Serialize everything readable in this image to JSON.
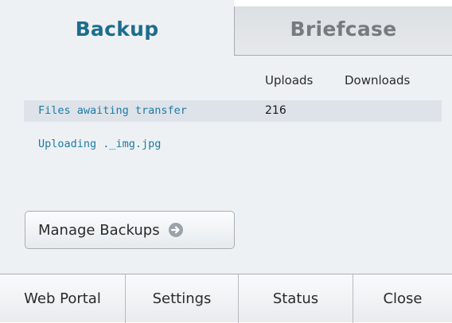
{
  "tabs": [
    {
      "label": "Backup",
      "active": true
    },
    {
      "label": "Briefcase",
      "active": false
    }
  ],
  "table": {
    "columns": [
      "Uploads",
      "Downloads"
    ],
    "rows": [
      {
        "label": "Files awaiting transfer",
        "uploads": "216",
        "downloads": ""
      }
    ]
  },
  "status": {
    "uploading_text": "Uploading ._img.jpg"
  },
  "manage_button": {
    "label": "Manage Backups",
    "icon": "arrow-right-circle-icon"
  },
  "bottom_bar": {
    "web_portal": "Web Portal",
    "settings": "Settings",
    "status": "Status",
    "close": "Close"
  },
  "colors": {
    "accent": "#1d6d8d",
    "link_text": "#1d7aa6",
    "panel_bg": "#eef1f4",
    "row_highlight": "#dde3e8"
  }
}
